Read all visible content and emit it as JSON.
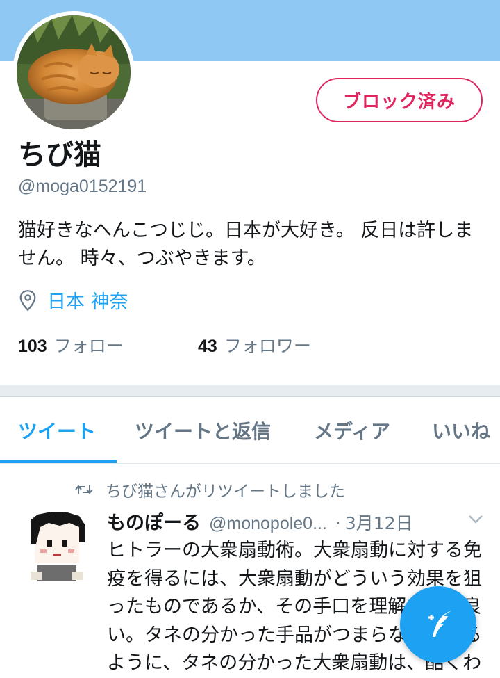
{
  "profile": {
    "name": "ちび猫",
    "handle": "@moga0152191",
    "bio": "猫好きなへんこつじじ。日本が大好き。 反日は許しません。 時々、つぶやきます。",
    "location": "日本 神奈",
    "following_count": "103",
    "following_label": "フォロー",
    "followers_count": "43",
    "followers_label": "フォロワー",
    "block_button_label": "ブロック済み"
  },
  "tabs": [
    {
      "label": "ツイート",
      "active": true
    },
    {
      "label": "ツイートと返信",
      "active": false
    },
    {
      "label": "メディア",
      "active": false
    },
    {
      "label": "いいね",
      "active": false
    }
  ],
  "tweet": {
    "retweet_notice": "ちび猫さんがリツイートしました",
    "author_name": "ものぽーる",
    "author_handle": "@monopole0...",
    "separator": "·",
    "date": "3月12日",
    "body": "ヒトラーの大衆扇動術。大衆扇動に対する免疫を得るには、大衆扇動がどういう効果を狙ったものであるか、その手口を理解すると良い。タネの分かった手品がつまらなく感じるように、タネの分かった大衆扇動は、酷くわざとらしく見える"
  },
  "icons": {
    "location": "location-pin-icon",
    "retweet": "retweet-icon",
    "caret": "chevron-down-icon",
    "compose": "compose-tweet-icon"
  },
  "colors": {
    "banner": "#8ec8f3",
    "accent": "#1da1f2",
    "blocked": "#e0245e",
    "secondary_text": "#657786"
  }
}
